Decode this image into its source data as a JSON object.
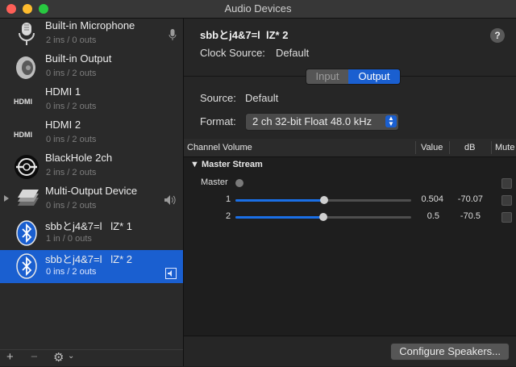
{
  "window": {
    "title": "Audio Devices",
    "lights": [
      "#fe5f57",
      "#febc2e",
      "#28c840"
    ]
  },
  "devices": [
    {
      "name": "Built-in Microphone",
      "sub": "2 ins / 0 outs",
      "icon": "microphone-icon"
    },
    {
      "name": "Built-in Output",
      "sub": "0 ins / 2 outs",
      "icon": "speaker-icon"
    },
    {
      "name": "HDMI 1",
      "sub": "0 ins / 2 outs",
      "icon": "hdmi-icon"
    },
    {
      "name": "HDMI 2",
      "sub": "0 ins / 2 outs",
      "icon": "hdmi-icon"
    },
    {
      "name": "BlackHole 2ch",
      "sub": "2 ins / 2 outs",
      "icon": "blackhole-icon"
    },
    {
      "name": "Multi-Output Device",
      "sub": "0 ins / 2 outs",
      "icon": "multi-output-icon"
    },
    {
      "name": "sbbとj4&7=l   lZ* 1",
      "sub": "1 in / 0 outs",
      "icon": "bluetooth-icon"
    },
    {
      "name": "sbbとj4&7=l   lZ* 2",
      "sub": "0 ins / 2 outs",
      "icon": "bluetooth-icon",
      "selected": true
    }
  ],
  "sidebar_footer": {
    "add": "+",
    "remove": "−",
    "gear": "⚙",
    "chevron": "⌄"
  },
  "detail": {
    "name": "sbbとj4&7=l  lZ* 2",
    "clock_label": "Clock Source:",
    "clock_value": "Default",
    "help": "?",
    "tabs": {
      "input": "Input",
      "output": "Output",
      "selected": "Output"
    },
    "source_label": "Source:",
    "source_value": "Default",
    "format_label": "Format:",
    "format_value": "2 ch 32-bit Float 48.0 kHz"
  },
  "table": {
    "headers": {
      "channel": "Channel Volume",
      "value": "Value",
      "db": "dB",
      "mute": "Mute"
    },
    "stream": "Master Stream",
    "rows": [
      {
        "label": "Master",
        "level": 0.0,
        "value": "",
        "db": ""
      },
      {
        "label": "1",
        "level": 0.504,
        "value": "0.504",
        "db": "-70.07"
      },
      {
        "label": "2",
        "level": 0.5,
        "value": "0.5",
        "db": "-70.5"
      }
    ]
  },
  "configure_button": "Configure Speakers..."
}
